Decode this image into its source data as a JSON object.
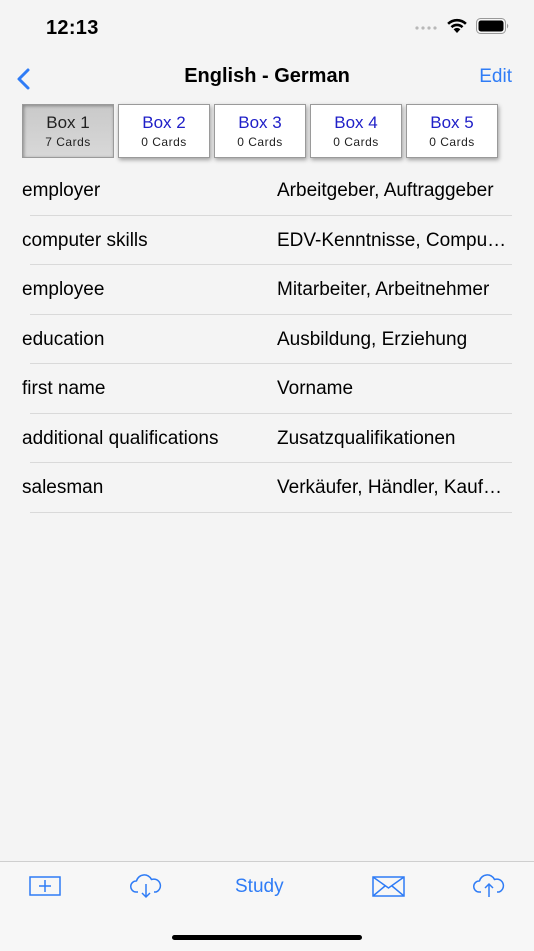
{
  "status": {
    "time": "12:13"
  },
  "nav": {
    "title": "English - German",
    "edit_label": "Edit"
  },
  "boxes": [
    {
      "label": "Box 1",
      "count": "7 Cards",
      "selected": true
    },
    {
      "label": "Box 2",
      "count": "0 Cards"
    },
    {
      "label": "Box 3",
      "count": "0 Cards"
    },
    {
      "label": "Box 4",
      "count": "0 Cards"
    },
    {
      "label": "Box 5",
      "count": "0 Cards"
    }
  ],
  "cards": [
    {
      "english": "employer",
      "german": "Arbeitgeber, Auftraggeber"
    },
    {
      "english": "computer skills",
      "german": "EDV-Kenntnisse, Computerkenntnisse"
    },
    {
      "english": "employee",
      "german": "Mitarbeiter, Arbeitnehmer"
    },
    {
      "english": "education",
      "german": "Ausbildung, Erziehung"
    },
    {
      "english": "first name",
      "german": "Vorname"
    },
    {
      "english": "additional qualifications",
      "german": "Zusatzqualifikationen"
    },
    {
      "english": "salesman",
      "german": "Verkäufer, Händler, Kaufmann"
    }
  ],
  "toolbar": {
    "icons": [
      "add-card-icon",
      "cloud-download-icon",
      "mail-icon",
      "cloud-upload-icon"
    ],
    "study_label": "Study"
  },
  "colors": {
    "accent": "#2f7cf6",
    "box_label": "#2020c8"
  }
}
